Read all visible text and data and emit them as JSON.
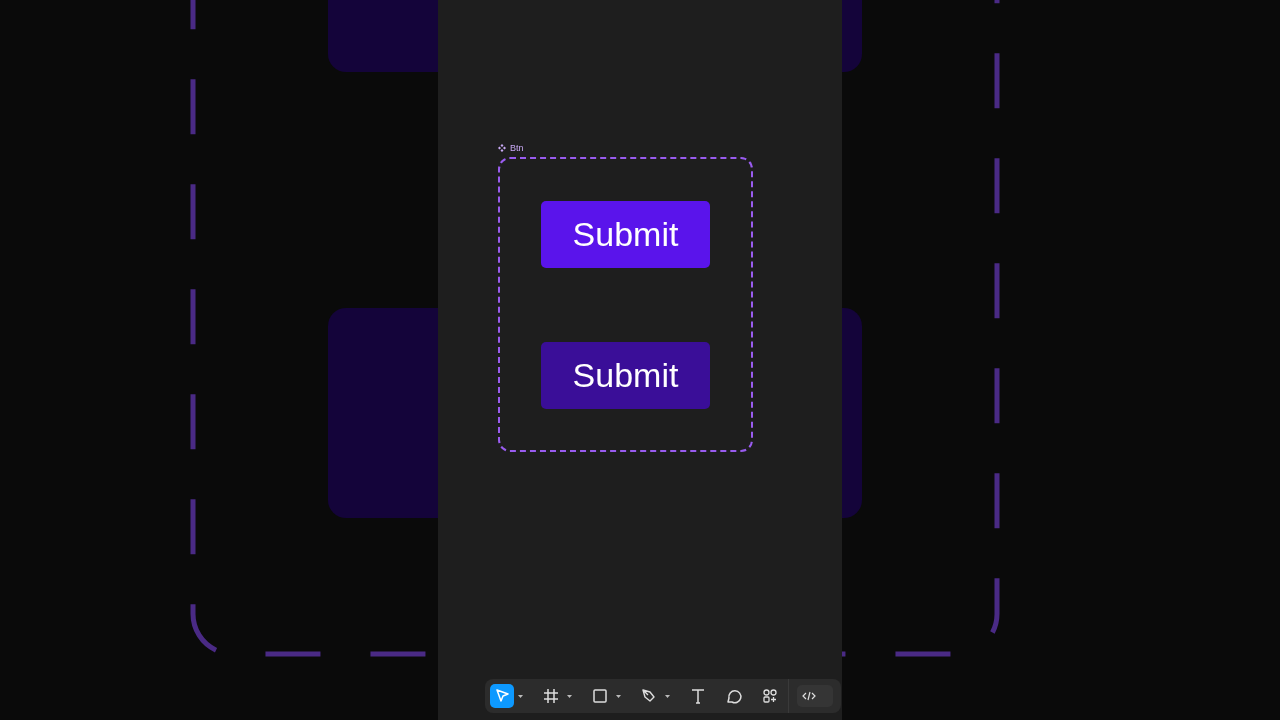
{
  "frame": {
    "label": "Btn"
  },
  "buttons": [
    {
      "label": "Submit",
      "kind": "default"
    },
    {
      "label": "Submit",
      "kind": "pressed"
    }
  ],
  "toolbar": [
    {
      "kind": "move",
      "selected": true,
      "has_menu": true
    },
    {
      "kind": "frame",
      "selected": false,
      "has_menu": true
    },
    {
      "kind": "rectangle",
      "selected": false,
      "has_menu": true
    },
    {
      "kind": "pen",
      "selected": false,
      "has_menu": true
    },
    {
      "kind": "text",
      "selected": false,
      "has_menu": false
    },
    {
      "kind": "comment",
      "selected": false,
      "has_menu": false
    },
    {
      "kind": "actions",
      "selected": false,
      "has_menu": false
    }
  ],
  "dev_mode": {
    "on": false
  }
}
